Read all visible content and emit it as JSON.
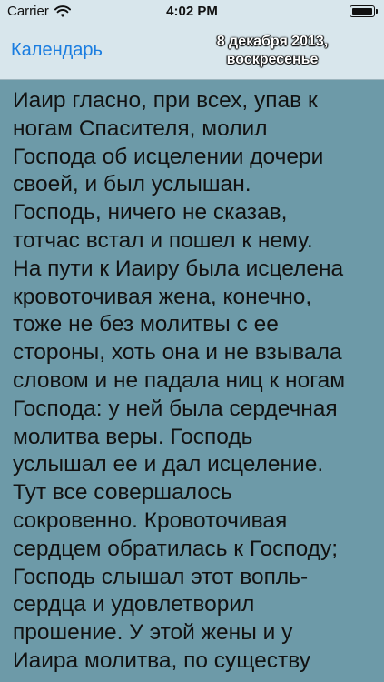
{
  "status_bar": {
    "carrier": "Carrier",
    "time": "4:02 PM"
  },
  "nav": {
    "back_label": "Календарь",
    "date_line1": "8 декабря 2013,",
    "date_line2": "воскресенье"
  },
  "reading": {
    "lines": [
      "Иаир гласно, при всех, упав к",
      "ногам Спасителя, молил",
      "Господа об исцелении дочери",
      "своей, и был услышан.",
      "Господь, ничего не сказав,",
      "тотчас встал и пошел к нему.",
      "На пути к Иаиру была исцелена",
      "кровоточивая жена, конечно,",
      "тоже не без молитвы с ее",
      "стороны, хоть она и не взывала",
      "словом и не падала ниц к ногам",
      "Господа: у ней была сердечная",
      "молитва веры. Господь",
      "услышал ее и дал исцеление.",
      "Тут все совершалось",
      "сокровенно. Кровоточивая",
      "сердцем обратилась к Господу;",
      "Господь слышал этот вопль-",
      "сердца и удовлетворил",
      "прошение. У этой жены и у",
      "Иаира молитва, по существу"
    ]
  }
}
